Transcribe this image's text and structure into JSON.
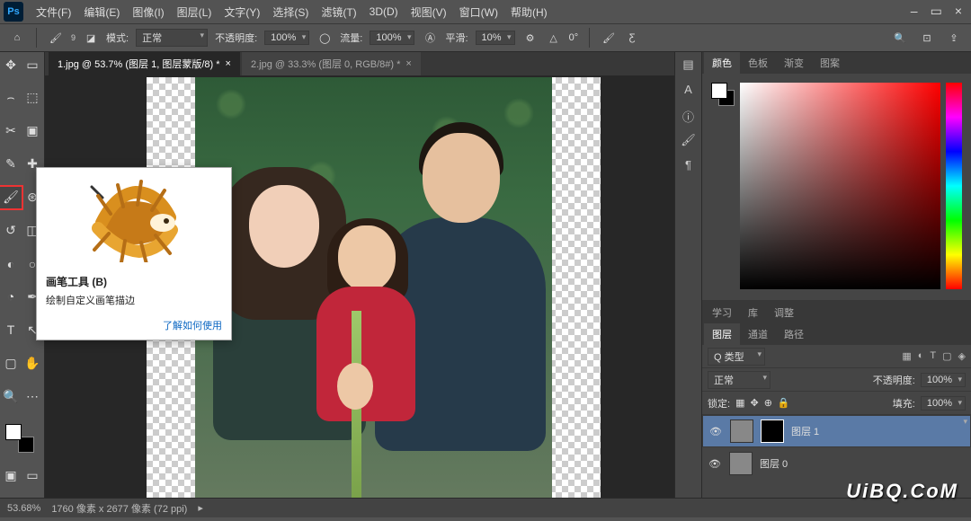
{
  "menu": {
    "file": "文件(F)",
    "edit": "编辑(E)",
    "image": "图像(I)",
    "layer": "图层(L)",
    "type": "文字(Y)",
    "select": "选择(S)",
    "filter": "滤镜(T)",
    "td": "3D(D)",
    "view": "视图(V)",
    "window": "窗口(W)",
    "help": "帮助(H)"
  },
  "opt": {
    "mode_lbl": "模式:",
    "mode": "正常",
    "opacity_lbl": "不透明度:",
    "opacity": "100%",
    "flow_lbl": "流量:",
    "flow": "100%",
    "smooth_lbl": "平滑:",
    "smooth": "10%",
    "angle": "0°",
    "size": "9"
  },
  "tabs": {
    "t1": "1.jpg @ 53.7% (图层 1, 图层蒙版/8) *",
    "t2": "2.jpg @ 33.3% (图层 0, RGB/8#) *"
  },
  "panel": {
    "color": "颜色",
    "swatches": "色板",
    "grad": "渐变",
    "pattern": "图案",
    "learn": "学习",
    "lib": "库",
    "adjust": "调整",
    "layers": "图层",
    "channels": "通道",
    "paths": "路径"
  },
  "layer": {
    "kind": "Q 类型",
    "blend": "正常",
    "op_lbl": "不透明度:",
    "op": "100%",
    "lock_lbl": "锁定:",
    "fill_lbl": "填充:",
    "fill": "100%",
    "l1": "图层 1",
    "l0": "图层 0"
  },
  "status": {
    "zoom": "53.68%",
    "dim": "1760 像素 x 2677 像素 (72 ppi)"
  },
  "tip": {
    "title": "画笔工具 (B)",
    "desc": "绘制自定义画笔描边",
    "link": "了解如何使用"
  },
  "watermark": "UiBQ.CoM"
}
